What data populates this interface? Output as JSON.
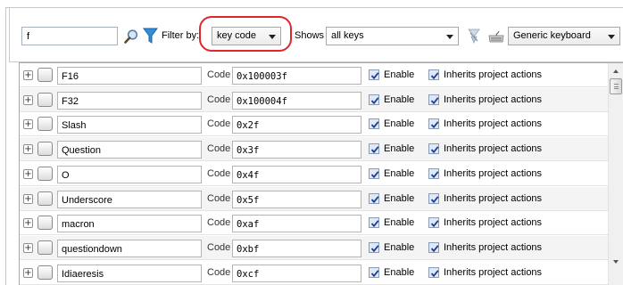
{
  "toolbar": {
    "search_value": "f",
    "filter_label": "Filter by:",
    "filter_value": "key code",
    "shows_label": "Shows :",
    "shows_value": "all keys",
    "keyboard_value": "Generic keyboard"
  },
  "labels": {
    "code": "Code",
    "enable": "Enable",
    "inherits": "Inherits project actions"
  },
  "rows": [
    {
      "name": "F16",
      "code": "0x100003f",
      "enable": true,
      "inherits": true
    },
    {
      "name": "F32",
      "code": "0x100004f",
      "enable": true,
      "inherits": true
    },
    {
      "name": "Slash",
      "code": "0x2f",
      "enable": true,
      "inherits": true
    },
    {
      "name": "Question",
      "code": "0x3f",
      "enable": true,
      "inherits": true
    },
    {
      "name": "O",
      "code": "0x4f",
      "enable": true,
      "inherits": true
    },
    {
      "name": "Underscore",
      "code": "0x5f",
      "enable": true,
      "inherits": true
    },
    {
      "name": "macron",
      "code": "0xaf",
      "enable": true,
      "inherits": true
    },
    {
      "name": "questiondown",
      "code": "0xbf",
      "enable": true,
      "inherits": true
    },
    {
      "name": "Idiaeresis",
      "code": "0xcf",
      "enable": true,
      "inherits": true
    }
  ],
  "colors": {
    "highlight": "#e0262c",
    "check": "#1d3f8e"
  },
  "icons": [
    "magnifier-icon",
    "filter-funnel-icon",
    "clear-filter-icon",
    "keyboard-icon",
    "expand-plus-icon",
    "key-icon"
  ]
}
